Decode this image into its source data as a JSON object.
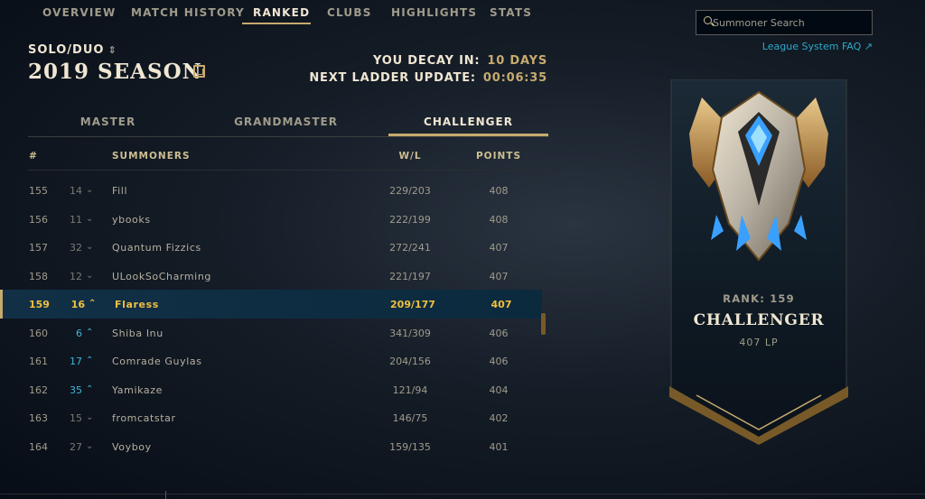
{
  "nav": {
    "items": [
      "OVERVIEW",
      "MATCH HISTORY",
      "RANKED",
      "CLUBS",
      "HIGHLIGHTS",
      "STATS"
    ],
    "active": "RANKED"
  },
  "header": {
    "queue": "SOLO/DUO",
    "season": "2019 SEASON",
    "decay_label": "YOU DECAY IN:",
    "decay_value": "10 DAYS",
    "update_label": "NEXT LADDER UPDATE:",
    "update_value": "00:06:35"
  },
  "tiers": {
    "tabs": [
      "MASTER",
      "GRANDMASTER",
      "CHALLENGER"
    ],
    "active": "CHALLENGER"
  },
  "table": {
    "headers": {
      "pos": "#",
      "summoners": "SUMMONERS",
      "wl": "W/L",
      "points": "POINTS"
    },
    "rows": [
      {
        "pos": "155",
        "change": "14",
        "dir": "down",
        "name": "Fill",
        "wl": "229/203",
        "points": "408"
      },
      {
        "pos": "156",
        "change": "11",
        "dir": "down",
        "name": "ybooks",
        "wl": "222/199",
        "points": "408"
      },
      {
        "pos": "157",
        "change": "32",
        "dir": "down",
        "name": "Quantum Fizzics",
        "wl": "272/241",
        "points": "407"
      },
      {
        "pos": "158",
        "change": "12",
        "dir": "down",
        "name": "ULookSoCharming",
        "wl": "221/197",
        "points": "407"
      },
      {
        "pos": "159",
        "change": "16",
        "dir": "up",
        "name": "Flaress",
        "wl": "209/177",
        "points": "407",
        "highlight": true
      },
      {
        "pos": "160",
        "change": "6",
        "dir": "up",
        "name": "Shiba Inu",
        "wl": "341/309",
        "points": "406"
      },
      {
        "pos": "161",
        "change": "17",
        "dir": "up",
        "name": "Comrade Guylas",
        "wl": "204/156",
        "points": "406"
      },
      {
        "pos": "162",
        "change": "35",
        "dir": "up",
        "name": "Yamikaze",
        "wl": "121/94",
        "points": "404"
      },
      {
        "pos": "163",
        "change": "15",
        "dir": "down",
        "name": "fromcatstar",
        "wl": "146/75",
        "points": "402"
      },
      {
        "pos": "164",
        "change": "27",
        "dir": "down",
        "name": "Voyboy",
        "wl": "159/135",
        "points": "401"
      }
    ]
  },
  "search": {
    "placeholder": "Summoner Search"
  },
  "faq_label": "League System FAQ",
  "rank_card": {
    "rank_label": "RANK: 159",
    "tier": "CHALLENGER",
    "lp": "407 LP",
    "emblem_icon": "challenger-emblem-icon"
  },
  "colors": {
    "gold": "#c8aa6e",
    "highlight_text": "#f0c040",
    "up": "#3db8d6",
    "down": "#7a7a74"
  }
}
